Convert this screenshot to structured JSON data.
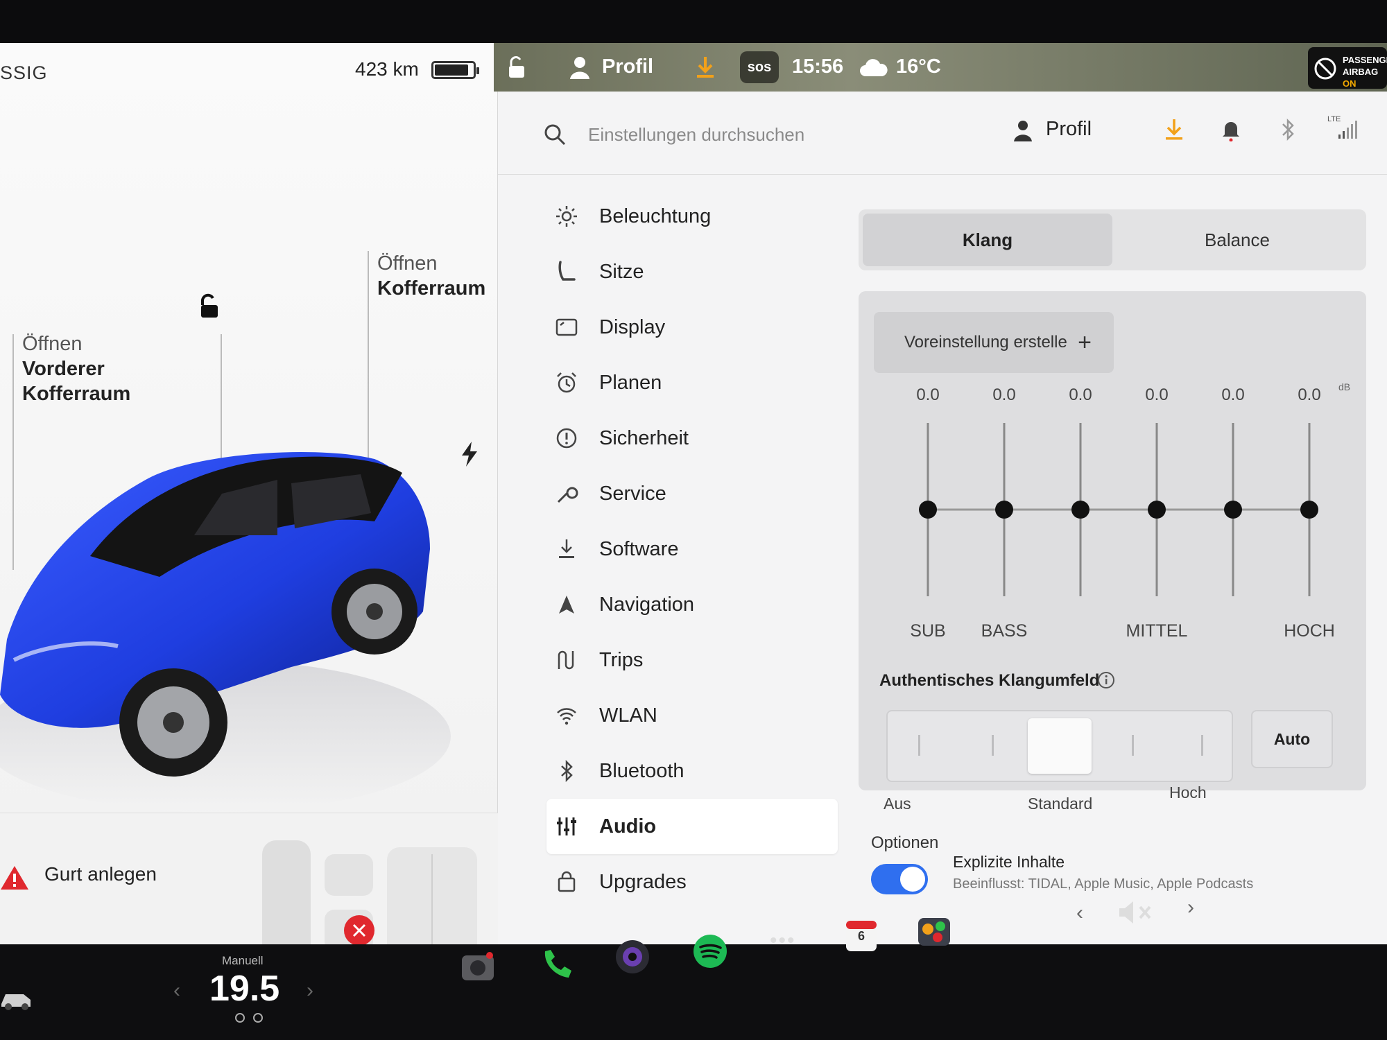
{
  "car": {
    "gear_state": "SSIG",
    "range": "423 km",
    "battery_level": 0.85,
    "trunk_label": {
      "line1": "Öffnen",
      "line2": "Kofferraum"
    },
    "frunk_label": {
      "line1": "Öffnen",
      "line2": "Vorderer",
      "line3": "Kofferraum"
    },
    "seatbelt_warning": "Gurt anlegen",
    "car_color": "#1f3ee0"
  },
  "status_bar": {
    "profile_label": "Profil",
    "sos_label": "sos",
    "time": "15:56",
    "temperature": "16°C",
    "airbag_line1": "PASSENGE",
    "airbag_line2": "AIRBAG",
    "airbag_state": "ON"
  },
  "settings": {
    "search_placeholder": "Einstellungen durchsuchen",
    "profile_label": "Profil",
    "lte_label": "LTE",
    "menu": [
      {
        "label": "Beleuchtung",
        "icon": "brightness-icon"
      },
      {
        "label": "Sitze",
        "icon": "seat-icon"
      },
      {
        "label": "Display",
        "icon": "display-icon"
      },
      {
        "label": "Planen",
        "icon": "alarm-clock-icon"
      },
      {
        "label": "Sicherheit",
        "icon": "alert-circle-icon"
      },
      {
        "label": "Service",
        "icon": "wrench-icon"
      },
      {
        "label": "Software",
        "icon": "download-icon"
      },
      {
        "label": "Navigation",
        "icon": "navigation-arrow-icon"
      },
      {
        "label": "Trips",
        "icon": "trips-icon"
      },
      {
        "label": "WLAN",
        "icon": "wifi-icon"
      },
      {
        "label": "Bluetooth",
        "icon": "bluetooth-icon"
      },
      {
        "label": "Audio",
        "icon": "equalizer-icon",
        "active": true
      },
      {
        "label": "Upgrades",
        "icon": "shopping-bag-icon"
      }
    ]
  },
  "audio": {
    "tabs": {
      "klang": "Klang",
      "balance": "Balance"
    },
    "preset_label": "Voreinstellung erstelle",
    "db_unit": "dB",
    "eq_values": [
      "0.0",
      "0.0",
      "0.0",
      "0.0",
      "0.0",
      "0.0"
    ],
    "band_labels": {
      "sub": "SUB",
      "bass": "BASS",
      "mittel": "MITTEL",
      "hoch": "HOCH"
    },
    "soundfield_label": "Authentisches Klangumfeld",
    "soundfield_captions": {
      "aus": "Aus",
      "standard": "Standard",
      "hoch": "Hoch"
    },
    "soundfield_level": 0.5,
    "auto_label": "Auto",
    "options_label": "Optionen",
    "explicit_label": "Explizite Inhalte",
    "explicit_sub": "Beeinflusst: TIDAL, Apple Music, Apple Podcasts",
    "explicit_enabled": true
  },
  "taskbar": {
    "climate_mode": "Manuell",
    "climate_temp": "19.5",
    "calendar_day": "6",
    "more_label": "•••"
  },
  "colors": {
    "toggle_on": "#2f6fef",
    "download_accent": "#f2a11a",
    "phone_green": "#2ec24a",
    "spotify_green": "#1db954"
  }
}
